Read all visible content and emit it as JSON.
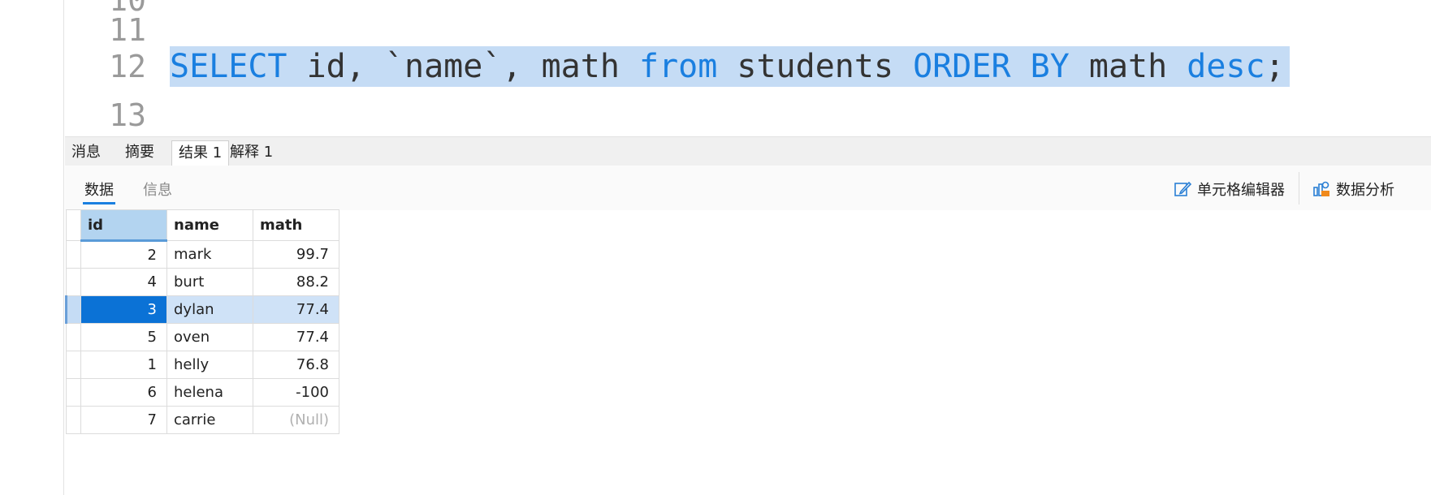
{
  "editor": {
    "lines": [
      {
        "num": "10",
        "code": ""
      },
      {
        "num": "11",
        "code": ""
      },
      {
        "num": "12",
        "code": "SELECT id, `name`, math from students ORDER BY math desc;"
      },
      {
        "num": "13",
        "code": ""
      }
    ],
    "sql_tokens": {
      "select": "SELECT",
      "cols": " id, `name`, math ",
      "from": "from",
      "table": " students ",
      "order_by": "ORDER BY",
      "order_col": " math ",
      "desc": "desc",
      "end": ";"
    }
  },
  "result_tabs": [
    "消息",
    "摘要",
    "结果 1",
    "解释 1"
  ],
  "active_result_tab": "结果 1",
  "sub_tabs": [
    "数据",
    "信息"
  ],
  "toolbar": {
    "cell_editor": "单元格编辑器",
    "data_analysis": "数据分析"
  },
  "table": {
    "columns": [
      "id",
      "name",
      "math"
    ],
    "rows": [
      {
        "id": "2",
        "name": "mark",
        "math": "99.7"
      },
      {
        "id": "4",
        "name": "burt",
        "math": "88.2"
      },
      {
        "id": "3",
        "name": "dylan",
        "math": "77.4"
      },
      {
        "id": "5",
        "name": "oven",
        "math": "77.4"
      },
      {
        "id": "1",
        "name": "helly",
        "math": "76.8"
      },
      {
        "id": "6",
        "name": "helena",
        "math": "-100"
      },
      {
        "id": "7",
        "name": "carrie",
        "math": "(Null)"
      }
    ],
    "selected_row_index": 2
  },
  "colors": {
    "keyword": "#1a7fe0",
    "selection": "#c5dcf5",
    "selected_cell": "#0b72d6"
  }
}
